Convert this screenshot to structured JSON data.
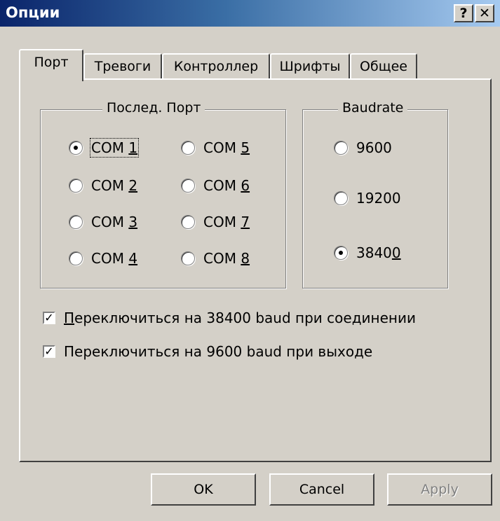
{
  "window": {
    "title": "Опции",
    "help_label": "?",
    "close_label": "✕"
  },
  "tabs": [
    {
      "label": "Порт",
      "active": true
    },
    {
      "label": "Тревоги"
    },
    {
      "label": "Контроллер"
    },
    {
      "label": "Шрифты"
    },
    {
      "label": "Общее"
    }
  ],
  "port_group": {
    "legend": "Послед. Порт",
    "options": [
      {
        "prefix": "COM ",
        "key": "1",
        "checked": true
      },
      {
        "prefix": "COM ",
        "key": "2"
      },
      {
        "prefix": "COM ",
        "key": "3"
      },
      {
        "prefix": "COM ",
        "key": "4"
      },
      {
        "prefix": "COM ",
        "key": "5"
      },
      {
        "prefix": "COM ",
        "key": "6"
      },
      {
        "prefix": "COM ",
        "key": "7"
      },
      {
        "prefix": "COM ",
        "key": "8"
      }
    ]
  },
  "baud_group": {
    "legend": "Baudrate",
    "options": [
      {
        "label": "9600"
      },
      {
        "label": "19200"
      },
      {
        "prefix": "3840",
        "key": "0",
        "checked": true
      }
    ]
  },
  "checkboxes": [
    {
      "first": "П",
      "rest": "ереключиться на 38400 baud при соединении",
      "checked": true
    },
    {
      "label": "Переключиться на 9600 baud при выходе",
      "checked": true
    }
  ],
  "buttons": {
    "ok": "OK",
    "cancel": "Cancel",
    "apply": "Apply"
  }
}
